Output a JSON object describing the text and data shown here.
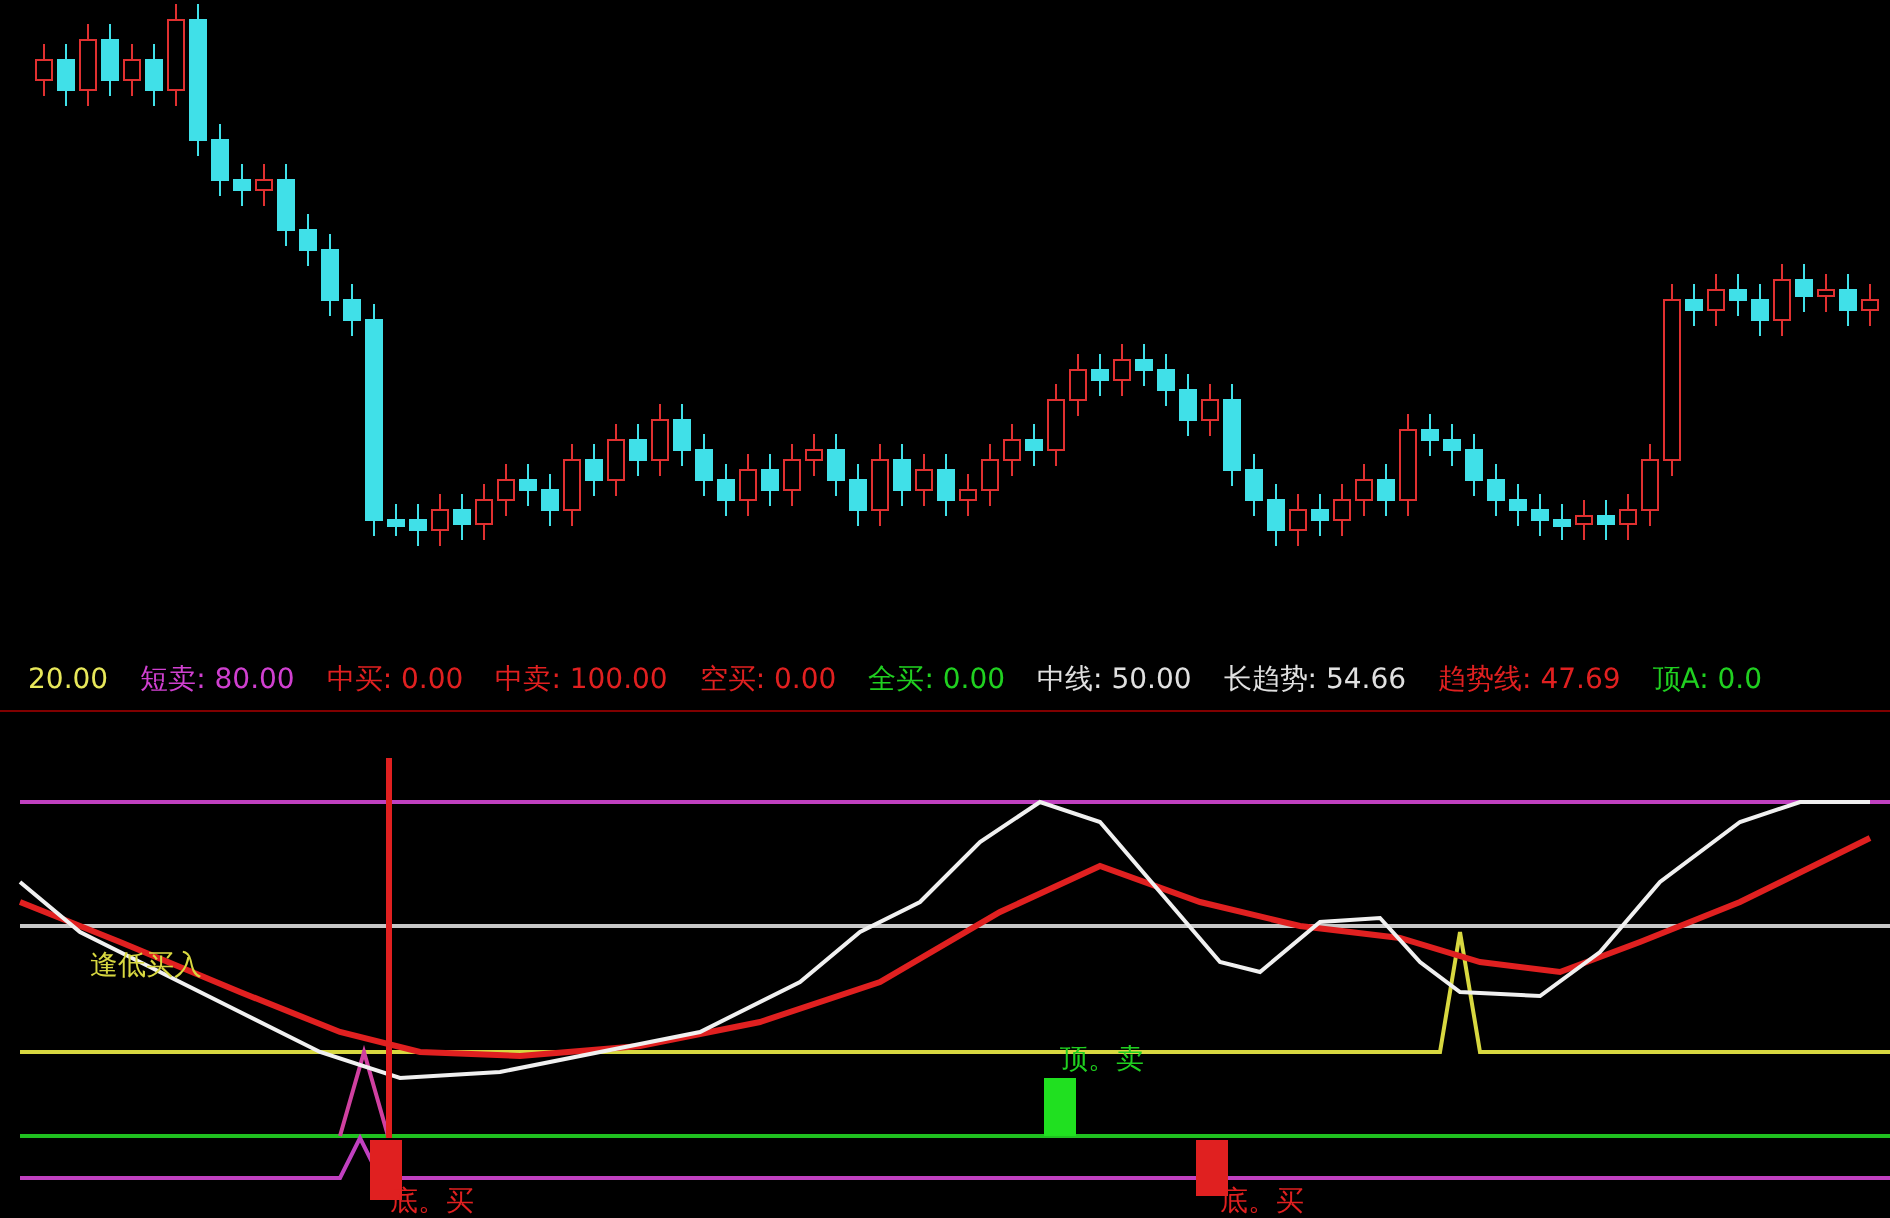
{
  "legend": [
    {
      "text": "20.00",
      "color": "#e8e85a"
    },
    {
      "text": "短卖: 80.00",
      "color": "#d040d0"
    },
    {
      "text": "中买: 0.00",
      "color": "#e02020"
    },
    {
      "text": "中卖: 100.00",
      "color": "#e02020"
    },
    {
      "text": "空买: 0.00",
      "color": "#e02020"
    },
    {
      "text": "全买: 0.00",
      "color": "#20d020"
    },
    {
      "text": "中线: 50.00",
      "color": "#e0e0e0"
    },
    {
      "text": "长趋势: 54.66",
      "color": "#e0e0e0"
    },
    {
      "text": "趋势线: 47.69",
      "color": "#e02020"
    },
    {
      "text": "顶A: 0.0",
      "color": "#20d020"
    }
  ],
  "signals": [
    {
      "text": "逢低买入",
      "color": "#d8d840"
    },
    {
      "text": "顶。卖",
      "color": "#20d020"
    },
    {
      "text": "底。买",
      "color": "#e02020"
    },
    {
      "text": "底。买",
      "color": "#e02020"
    }
  ]
}
